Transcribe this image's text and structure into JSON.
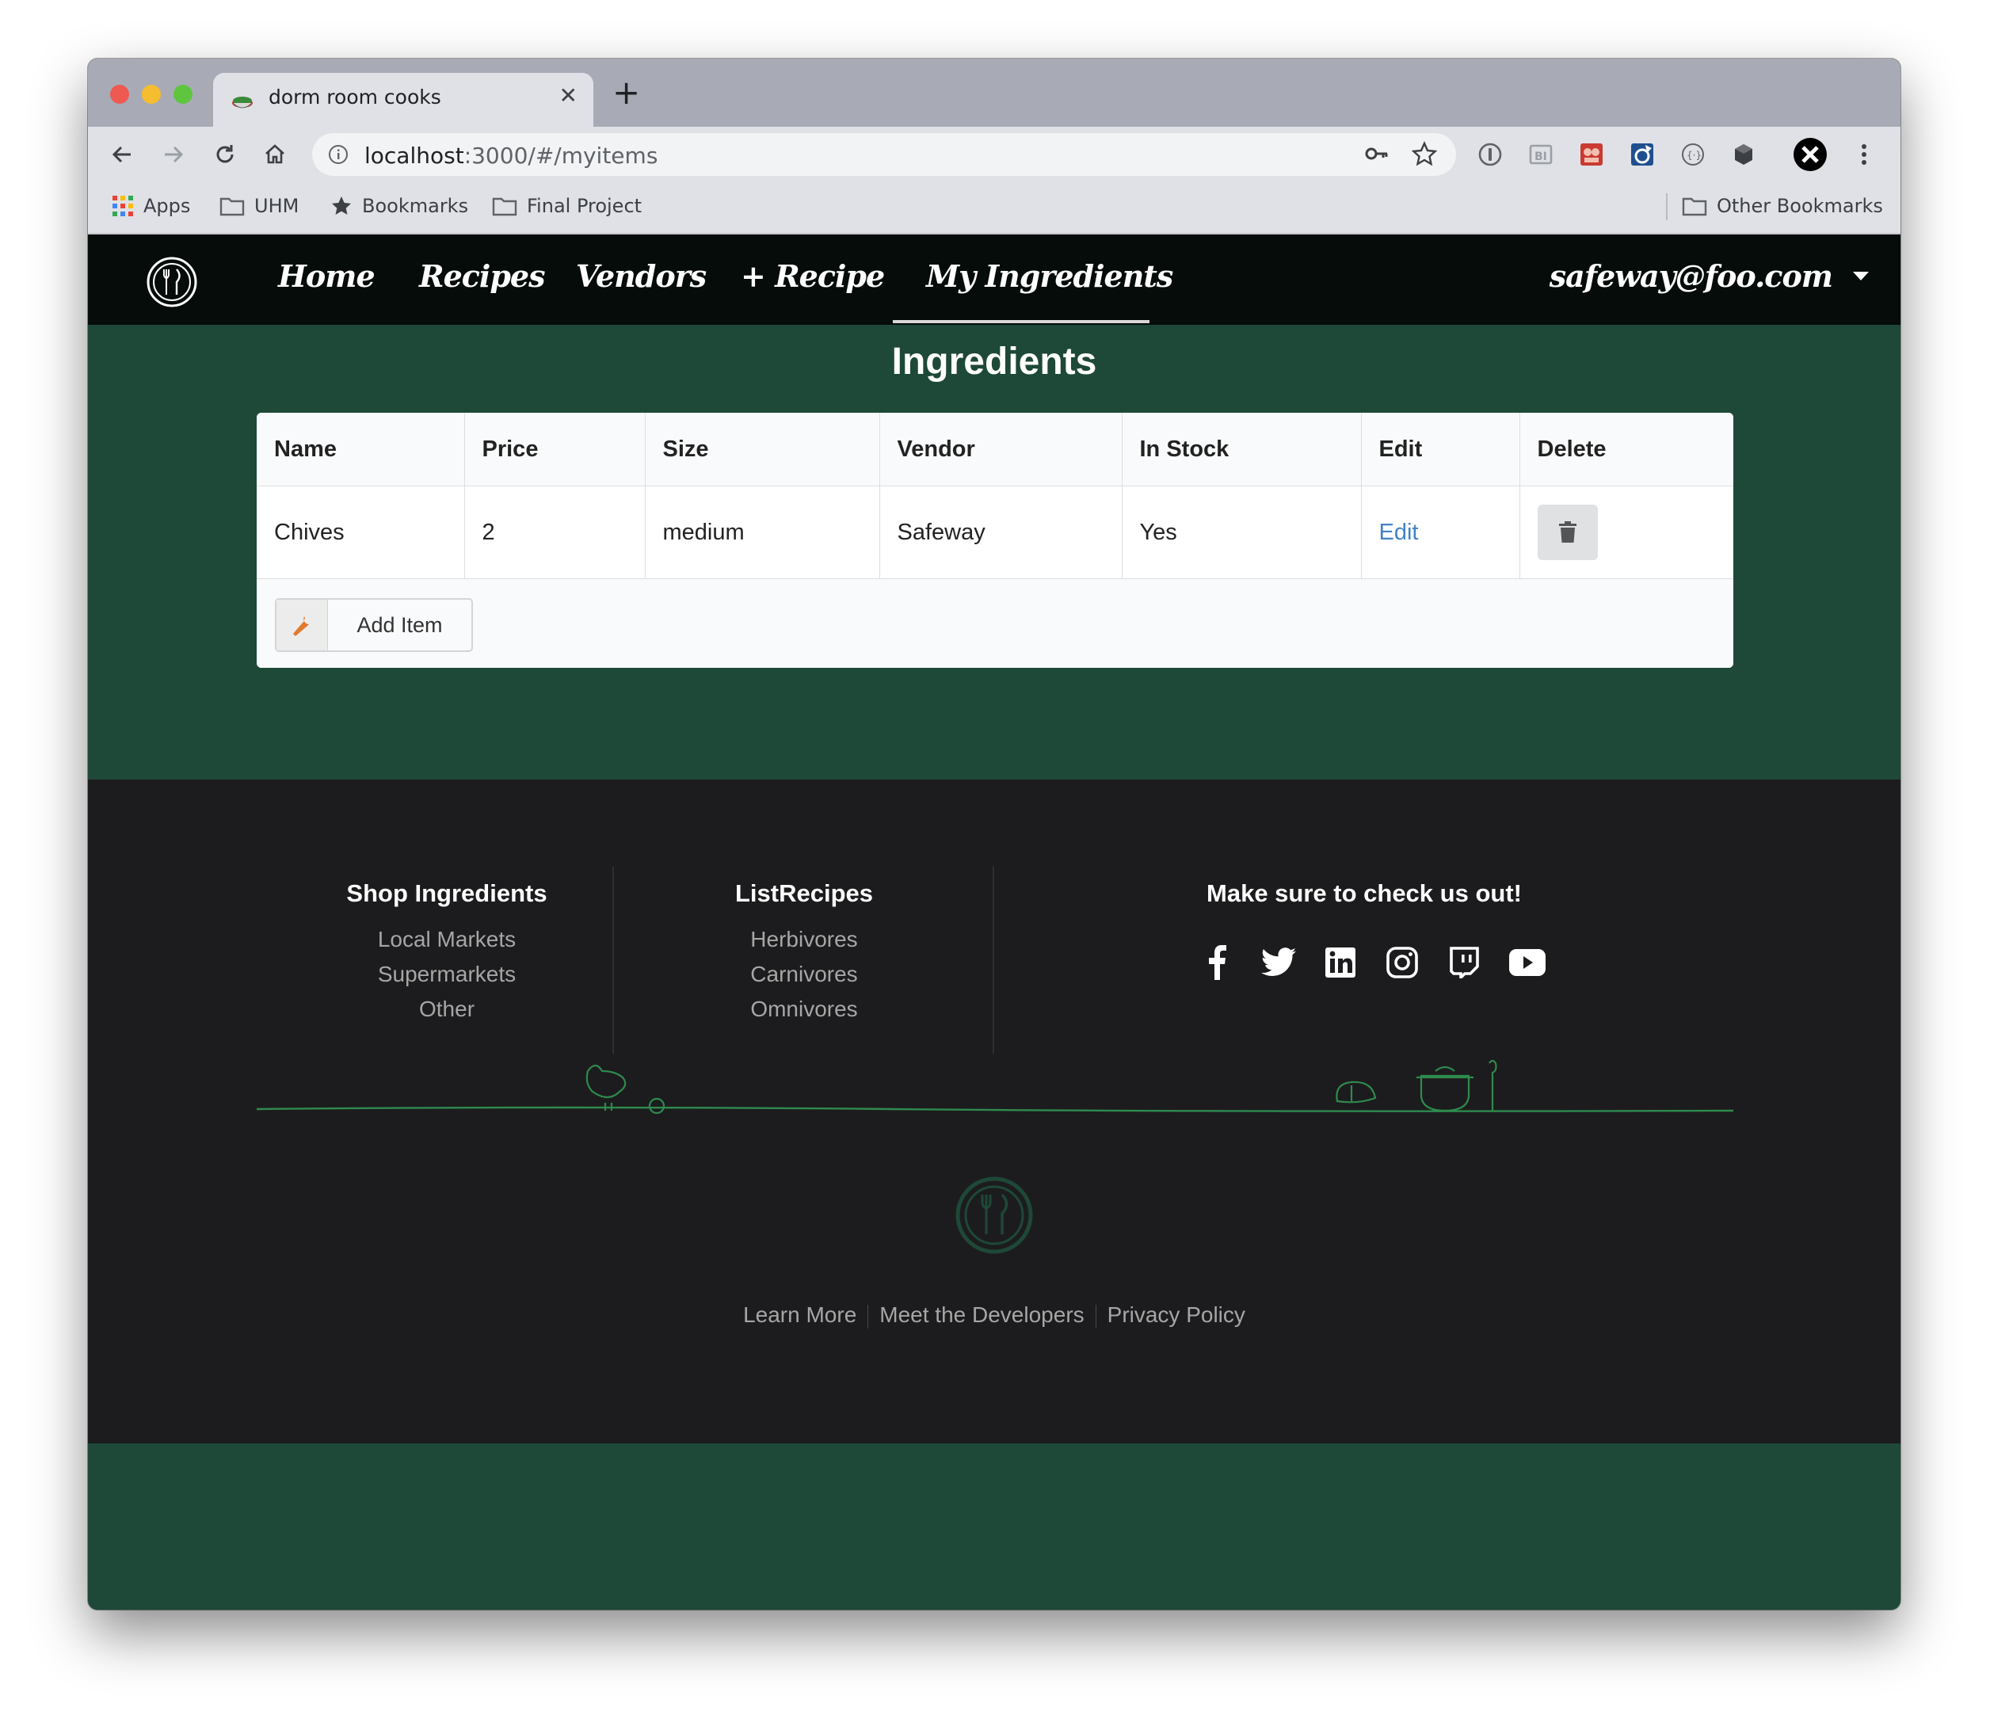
{
  "browser": {
    "tab_title": "dorm room cooks",
    "new_tab": "+",
    "url_host": "localhost",
    "url_rest": ":3000/#/myitems",
    "bookmarks": [
      "Apps",
      "UHM",
      "Bookmarks",
      "Final Project"
    ],
    "other_bookmarks": "Other Bookmarks"
  },
  "nav": {
    "items": [
      "Home",
      "Recipes",
      "Vendors",
      "+ Recipe",
      "My Ingredients"
    ],
    "active": "My Ingredients",
    "user": "safeway@foo.com"
  },
  "page": {
    "title": "Ingredients",
    "columns": [
      "Name",
      "Price",
      "Size",
      "Vendor",
      "In Stock",
      "Edit",
      "Delete"
    ],
    "rows": [
      {
        "name": "Chives",
        "price": "2",
        "size": "medium",
        "vendor": "Safeway",
        "in_stock": "Yes",
        "edit": "Edit"
      }
    ],
    "add_item_label": "Add Item"
  },
  "footer": {
    "col1": {
      "title": "Shop Ingredients",
      "links": [
        "Local Markets",
        "Supermarkets",
        "Other"
      ]
    },
    "col2": {
      "title": "ListRecipes",
      "links": [
        "Herbivores",
        "Carnivores",
        "Omnivores"
      ]
    },
    "col3": {
      "title": "Make sure to check us out!",
      "icons": [
        "facebook-icon",
        "twitter-icon",
        "linkedin-icon",
        "instagram-icon",
        "twitch-icon",
        "youtube-icon"
      ]
    },
    "bottom_links": [
      "Learn More",
      "Meet the Developers",
      "Privacy Policy"
    ]
  },
  "colors": {
    "page_green": "#1e4837",
    "navbar": "#050c0a",
    "footer": "#1c1c1e",
    "link": "#4183c4",
    "doodle": "#2e8b4e"
  }
}
